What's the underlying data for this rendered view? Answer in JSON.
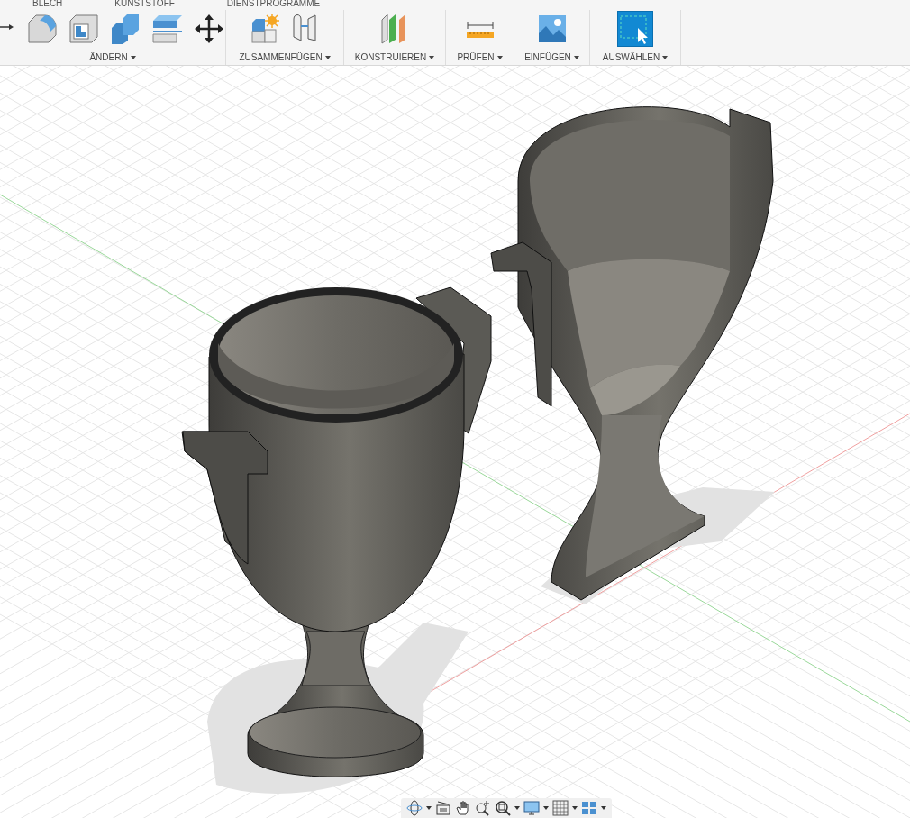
{
  "tabs": [
    {
      "label": "BLECH"
    },
    {
      "label": "KUNSTSTOFF"
    },
    {
      "label": "DIENSTPROGRAMME"
    }
  ],
  "toolbar_groups": [
    {
      "label": "ÄNDERN",
      "active": false
    },
    {
      "label": "ZUSAMMENFÜGEN",
      "active": false
    },
    {
      "label": "KONSTRUIEREN",
      "active": false
    },
    {
      "label": "PRÜFEN",
      "active": false
    },
    {
      "label": "EINFÜGEN",
      "active": false
    },
    {
      "label": "AUSWÄHLEN",
      "active": true
    }
  ]
}
